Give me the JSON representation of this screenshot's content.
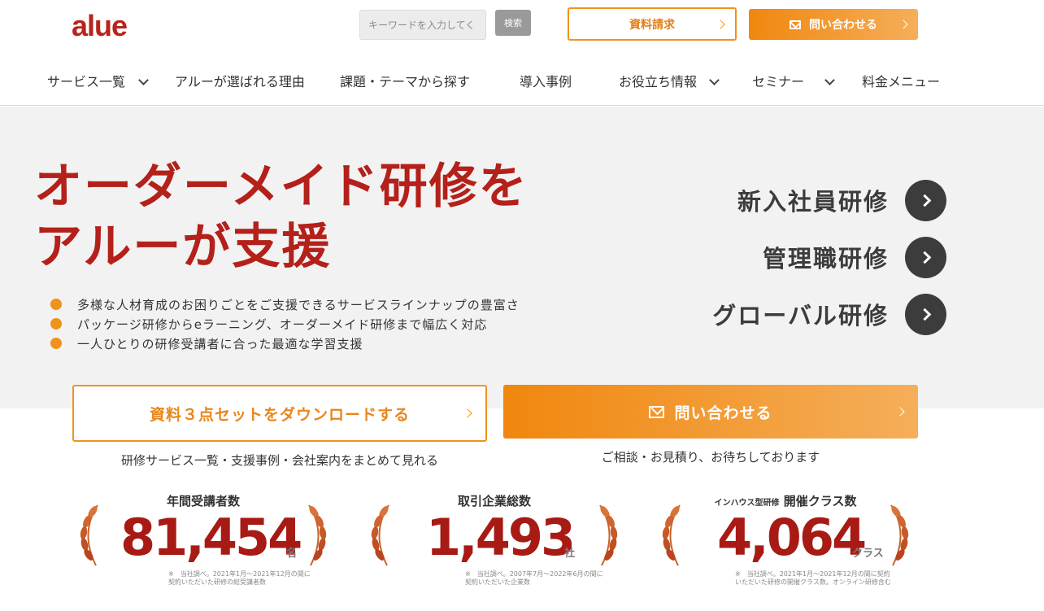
{
  "header": {
    "logo": "alue",
    "search_placeholder": "キーワードを入力してく",
    "search_button": "検索",
    "docs_button": "資料請求",
    "contact_button": "問い合わせる"
  },
  "nav": [
    {
      "label": "サービス一覧",
      "dropdown": true
    },
    {
      "label": "アルーが選ばれる理由",
      "dropdown": false
    },
    {
      "label": "課題・テーマから探す",
      "dropdown": false
    },
    {
      "label": "導入事例",
      "dropdown": false
    },
    {
      "label": "お役立ち情報",
      "dropdown": true
    },
    {
      "label": "セミナー",
      "dropdown": true
    },
    {
      "label": "料金メニュー",
      "dropdown": false
    }
  ],
  "hero": {
    "title_line1": "オーダーメイド研修を",
    "title_line2": "アルーが支援",
    "bullets": [
      "多様な人材育成のお困りごとをご支援できるサービスラインナップの豊富さ",
      "パッケージ研修からeラーニング、オーダーメイド研修まで幅広く対応",
      "一人ひとりの研修受講者に合った最適な学習支援"
    ],
    "trainings": [
      "新入社員研修",
      "管理職研修",
      "グローバル研修"
    ]
  },
  "cta": {
    "docs_label": "資料３点セットをダウンロードする",
    "docs_sub": "研修サービス一覧・支援事例・会社案内をまとめて見れる",
    "contact_label": "問い合わせる",
    "contact_sub": "ご相談・お見積り、お待ちしております"
  },
  "stats": [
    {
      "label": "年間受講者数",
      "label_prefix": "",
      "value": "81,454",
      "unit": "名",
      "note_line1": "※　当社調べ。2021年1月～2021年12月の間に",
      "note_line2": "契約いただいた研修の総受講者数"
    },
    {
      "label": "取引企業総数",
      "label_prefix": "",
      "value": "1,493",
      "unit": "社",
      "note_line1": "※　当社調べ。2007年7月～2022年6月の間に",
      "note_line2": "契約いただいた企業数"
    },
    {
      "label": "開催クラス数",
      "label_prefix": "インハウス型研修",
      "value": "4,064",
      "unit": "クラス",
      "note_line1": "※　当社調べ。2021年1月～2021年12月の間に契約",
      "note_line2": "いただいた研修の開催クラス数。オンライン研修含む"
    }
  ],
  "colors": {
    "brand_red": "#b4201a",
    "accent_orange": "#f0921e",
    "dark_circle": "#3c3c3c"
  }
}
